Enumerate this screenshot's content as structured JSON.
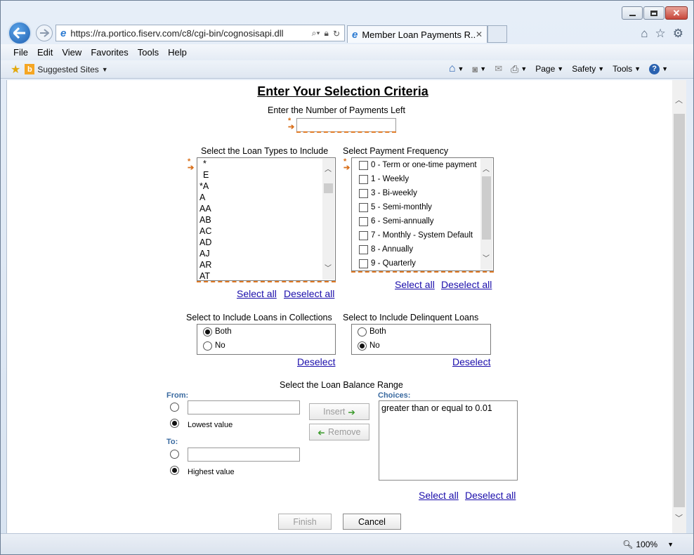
{
  "browser": {
    "url": "https://ra.portico.fiserv.com/c8/cgi-bin/cognosisapi.dll",
    "tab_title": "Member Loan Payments R...",
    "menu": [
      "File",
      "Edit",
      "View",
      "Favorites",
      "Tools",
      "Help"
    ],
    "favorites": {
      "suggested_sites": "Suggested Sites"
    },
    "commands": {
      "page": "Page",
      "safety": "Safety",
      "tools": "Tools"
    },
    "zoom": "100%"
  },
  "page": {
    "title": "Enter Your Selection Criteria",
    "payments_left": {
      "label": "Enter the Number of Payments Left",
      "value": ""
    },
    "loan_types": {
      "label": "Select the Loan Types to Include",
      "items": [
        "*",
        "E",
        "*A",
        "A",
        "AA",
        "AB",
        "AC",
        "AD",
        "AJ",
        "AR",
        "AT"
      ],
      "select_all": "Select all",
      "deselect_all": "Deselect all"
    },
    "payment_frequency": {
      "label": "Select Payment Frequency",
      "items": [
        {
          "label": "0 - Term or one-time payment",
          "checked": false
        },
        {
          "label": "1 - Weekly",
          "checked": false
        },
        {
          "label": "3 - Bi-weekly",
          "checked": false
        },
        {
          "label": "5 - Semi-monthly",
          "checked": false
        },
        {
          "label": "6 - Semi-annually",
          "checked": false
        },
        {
          "label": "7 - Monthly - System Default",
          "checked": false
        },
        {
          "label": "8 - Annually",
          "checked": false
        },
        {
          "label": "9 - Quarterly",
          "checked": false
        }
      ],
      "select_all": "Select all",
      "deselect_all": "Deselect all"
    },
    "collections": {
      "label": "Select to Include Loans in Collections",
      "options": [
        {
          "label": "Both",
          "selected": true
        },
        {
          "label": "No",
          "selected": false
        }
      ],
      "deselect": "Deselect"
    },
    "delinquent": {
      "label": "Select to Include Delinquent Loans",
      "options": [
        {
          "label": "Both",
          "selected": false
        },
        {
          "label": "No",
          "selected": true
        }
      ],
      "deselect": "Deselect"
    },
    "balance_range": {
      "label": "Select the Loan Balance Range",
      "from_label": "From:",
      "to_label": "To:",
      "lowest": "Lowest value",
      "highest": "Highest value",
      "insert": "Insert",
      "remove": "Remove",
      "choices_label": "Choices:",
      "choices": [
        "greater than or equal to 0.01"
      ],
      "select_all": "Select all",
      "deselect_all": "Deselect all"
    },
    "finish": "Finish",
    "cancel": "Cancel"
  },
  "colors": {
    "required_marker": "#d96f1a",
    "link": "#1a0dab"
  }
}
